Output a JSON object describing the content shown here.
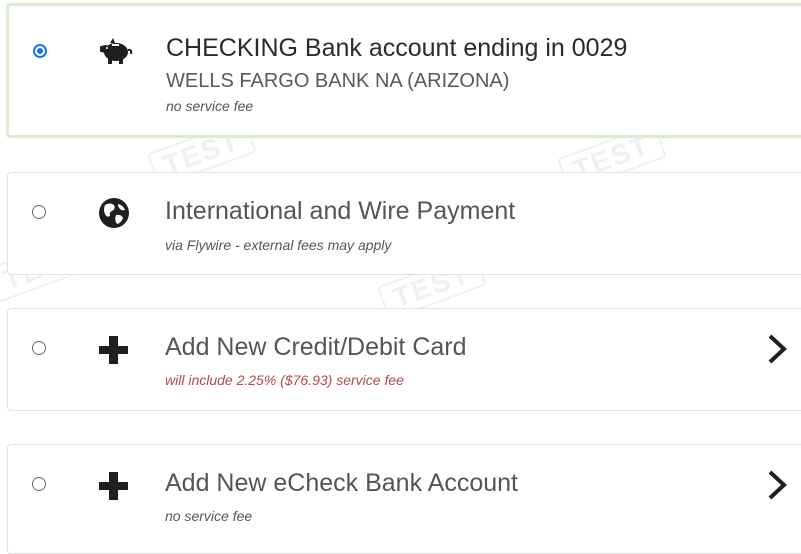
{
  "watermarks": [
    "TEST",
    "TEST",
    "TEST",
    "TEST"
  ],
  "payment_options": [
    {
      "title": "CHECKING Bank account ending in 0029",
      "subtitle": "WELLS FARGO BANK NA (ARIZONA)",
      "note": "no service fee",
      "icon": "piggy-bank-icon",
      "selected": true
    },
    {
      "title": "International and Wire Payment",
      "note": "via Flywire - external fees may apply",
      "icon": "globe-icon",
      "selected": false
    },
    {
      "title": "Add New Credit/Debit Card",
      "note": "will include 2.25% ($76.93) service fee",
      "note_color": "#b24a4a",
      "icon": "plus-icon",
      "selected": false
    },
    {
      "title": "Add New eCheck Bank Account",
      "note": "no service fee",
      "icon": "plus-icon",
      "selected": false
    }
  ],
  "colors": {
    "selected_border": "#dcebd3",
    "radio_checked": "#1a73e8",
    "fee_warning": "#b24a4a"
  }
}
